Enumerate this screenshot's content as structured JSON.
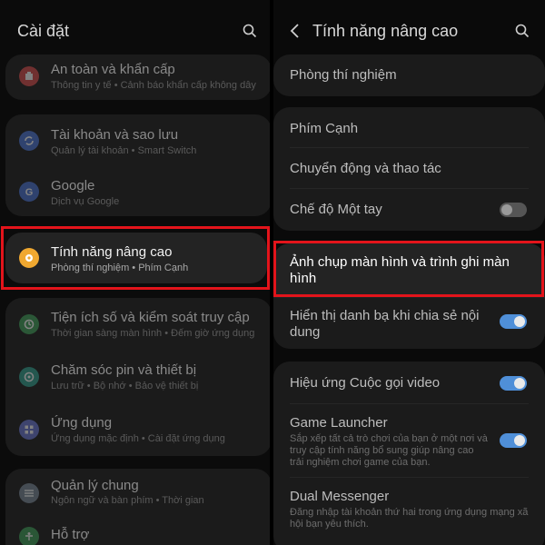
{
  "left": {
    "title": "Cài đặt",
    "items": [
      {
        "title": "An toàn và khẩn cấp",
        "subtitle": "Thông tin y tế • Cảnh báo khẩn cấp không dây",
        "icon": "emergency-icon",
        "color": "#d94c4c"
      },
      {
        "title": "Tài khoản và sao lưu",
        "subtitle": "Quản lý tài khoản • Smart Switch",
        "icon": "sync-icon",
        "color": "#4a74d6"
      },
      {
        "title": "Google",
        "subtitle": "Dịch vụ Google",
        "icon": "google-icon",
        "color": "#4a74d6"
      },
      {
        "title": "Tính năng nâng cao",
        "subtitle": "Phòng thí nghiệm • Phím Cạnh",
        "icon": "gear-plus-icon",
        "color": "#f0a830"
      },
      {
        "title": "Tiện ích số và kiểm soát truy cập",
        "subtitle": "Thời gian sàng màn hình • Đếm giờ ứng dụng",
        "icon": "digital-wellbeing-icon",
        "color": "#3fa15a"
      },
      {
        "title": "Chăm sóc pin và thiết bị",
        "subtitle": "Lưu trữ • Bộ nhớ • Bảo vệ thiết bị",
        "icon": "device-care-icon",
        "color": "#2fa08f"
      },
      {
        "title": "Ứng dụng",
        "subtitle": "Ứng dụng mặc định • Cài đặt ứng dụng",
        "icon": "apps-icon",
        "color": "#6a78d6"
      },
      {
        "title": "Quản lý chung",
        "subtitle": "Ngôn ngữ và bàn phím • Thời gian",
        "icon": "sliders-icon",
        "color": "#7a8a9a"
      },
      {
        "title": "Hỗ trợ",
        "subtitle": "",
        "icon": "accessibility-icon",
        "color": "#3fa15a"
      }
    ]
  },
  "right": {
    "title": "Tính năng nâng cao",
    "lab": "Phòng thí nghiệm",
    "edge": "Phím Cạnh",
    "motions": "Chuyển động và thao tác",
    "onehand": {
      "title": "Chế độ Một tay",
      "toggle": false
    },
    "screenshot": {
      "line1": "Ảnh chụp màn hình và trình ghi màn",
      "line2": "hình"
    },
    "contacts": {
      "line1": "Hiển thị danh bạ khi chia sẻ nội",
      "line2": "dung",
      "toggle": true
    },
    "video_effects": {
      "title": "Hiệu ứng Cuộc gọi video",
      "toggle": true
    },
    "game_launcher": {
      "title": "Game Launcher",
      "sub1": "Sắp xếp tất cả trò chơi của bạn ở một nơi và",
      "sub2": "truy cập tính năng bổ sung giúp nâng cao",
      "sub3": "trải nghiệm chơi game của bạn.",
      "toggle": true
    },
    "dual_messenger": {
      "title": "Dual Messenger",
      "sub1": "Đăng nhập tài khoản thứ hai trong ứng dụng mạng xã",
      "sub2": "hội bạn yêu thích."
    }
  },
  "highlight_color": "#e3141b"
}
